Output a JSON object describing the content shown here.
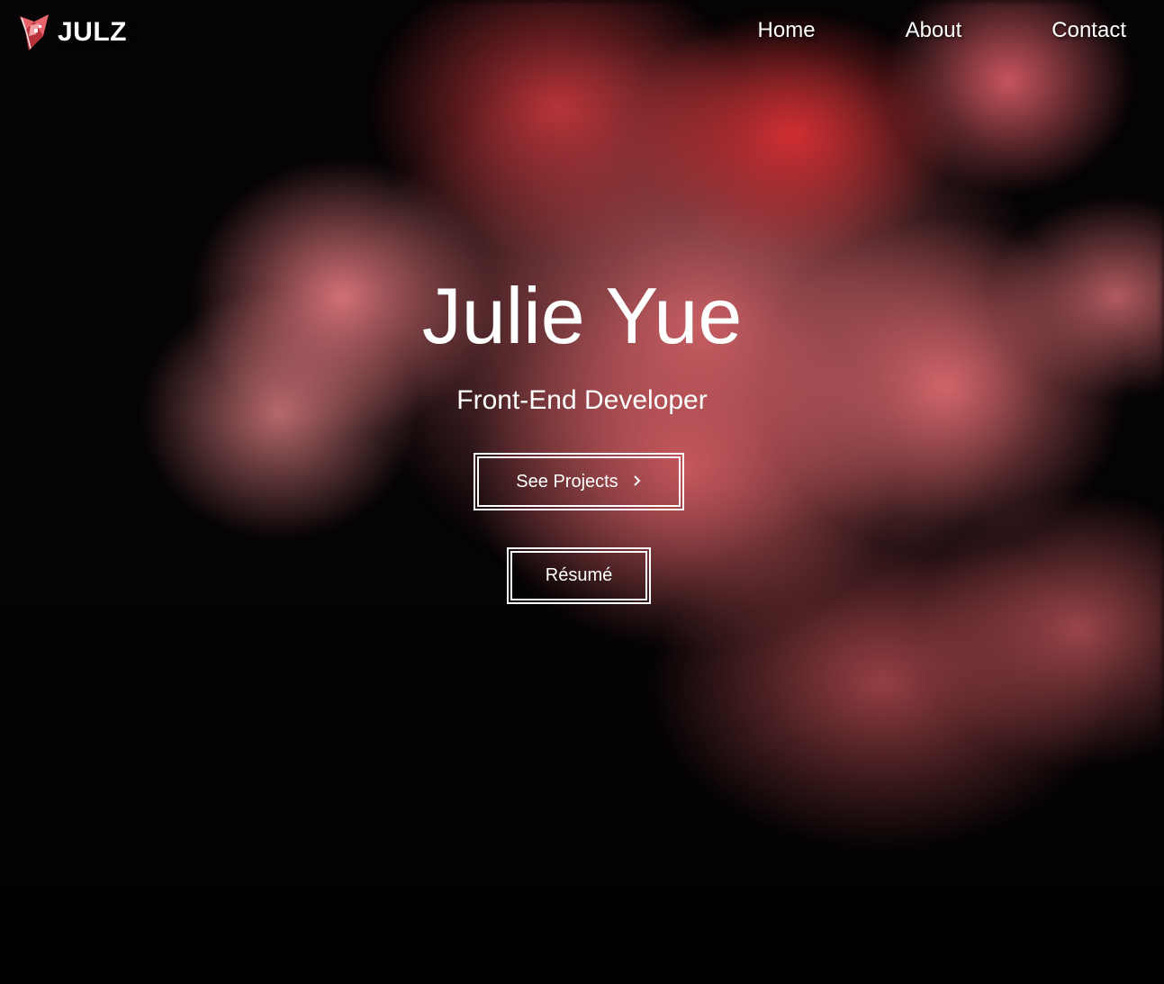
{
  "brand": {
    "name": "JULZ",
    "logo_icon": "pink-geometric-logo-icon",
    "accent_color": "#e8636b"
  },
  "nav": {
    "items": [
      {
        "label": "Home"
      },
      {
        "label": "About"
      },
      {
        "label": "Contact"
      }
    ]
  },
  "hero": {
    "title": "Julie Yue",
    "subtitle": "Front-End Developer",
    "buttons": {
      "projects_label": "See Projects",
      "projects_icon": "chevron-right-icon",
      "resume_label": "Résumé"
    }
  }
}
